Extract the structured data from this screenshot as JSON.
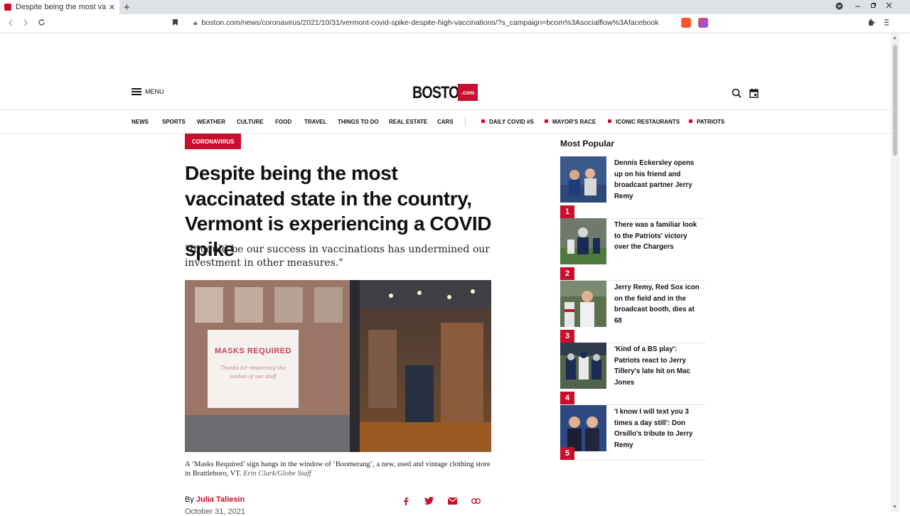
{
  "browser": {
    "tab_title": "Despite being the most va",
    "new_tab_glyph": "+",
    "close_glyph": "✕",
    "url": "boston.com/news/coronavirus/2021/10/31/vermont-covid-spike-despite-high-vaccinations/?s_campaign=bcom%3Asocialflow%3Afacebook"
  },
  "header": {
    "menu_label": "MENU",
    "logo_word": "BOSTON",
    "logo_suffix": ".com"
  },
  "nav": {
    "items": [
      "NEWS",
      "SPORTS",
      "WEATHER",
      "CULTURE",
      "FOOD",
      "TRAVEL",
      "THINGS TO DO",
      "REAL ESTATE",
      "CARS"
    ],
    "featured": [
      "DAILY COVID #S",
      "MAYOR'S RACE",
      "ICONIC RESTAURANTS",
      "PATRIOTS"
    ],
    "accent_color": "#c8102e"
  },
  "article": {
    "kicker": "CORONAVIRUS",
    "headline": "Despite being the most vaccinated state in the country, Vermont is experiencing a COVID spike",
    "dek": "\"It could be our success in vaccinations has undermined our investment in other measures.\"",
    "image_sign_title": "MASKS REQUIRED",
    "image_sign_subtitle": "Thanks for respecting the wishes of our staff",
    "caption": "A ‘Masks Required’ sign hangs in the window of ‘Boomerang’, a new, used and vintage clothing store in Brattleboro, VT.",
    "caption_credit": "Erin Clark/Globe Staff",
    "byline_prefix": "By",
    "author": "Julia Taliesin",
    "date": "October 31, 2021"
  },
  "most_popular": {
    "title": "Most Popular",
    "items": [
      {
        "rank": "1",
        "headline": "Dennis Eckersley opens up on his friend and broadcast partner Jerry Remy"
      },
      {
        "rank": "2",
        "headline": "There was a familiar look to the Patriots' victory over the Chargers"
      },
      {
        "rank": "3",
        "headline": "Jerry Remy, Red Sox icon on the field and in the broadcast booth, dies at 68"
      },
      {
        "rank": "4",
        "headline": "'Kind of a BS play': Patriots react to Jerry Tillery's late hit on Mac Jones"
      },
      {
        "rank": "5",
        "headline": "'I know I will text you 3 times a day still': Don Orsillo's tribute to Jerry Remy"
      }
    ]
  }
}
